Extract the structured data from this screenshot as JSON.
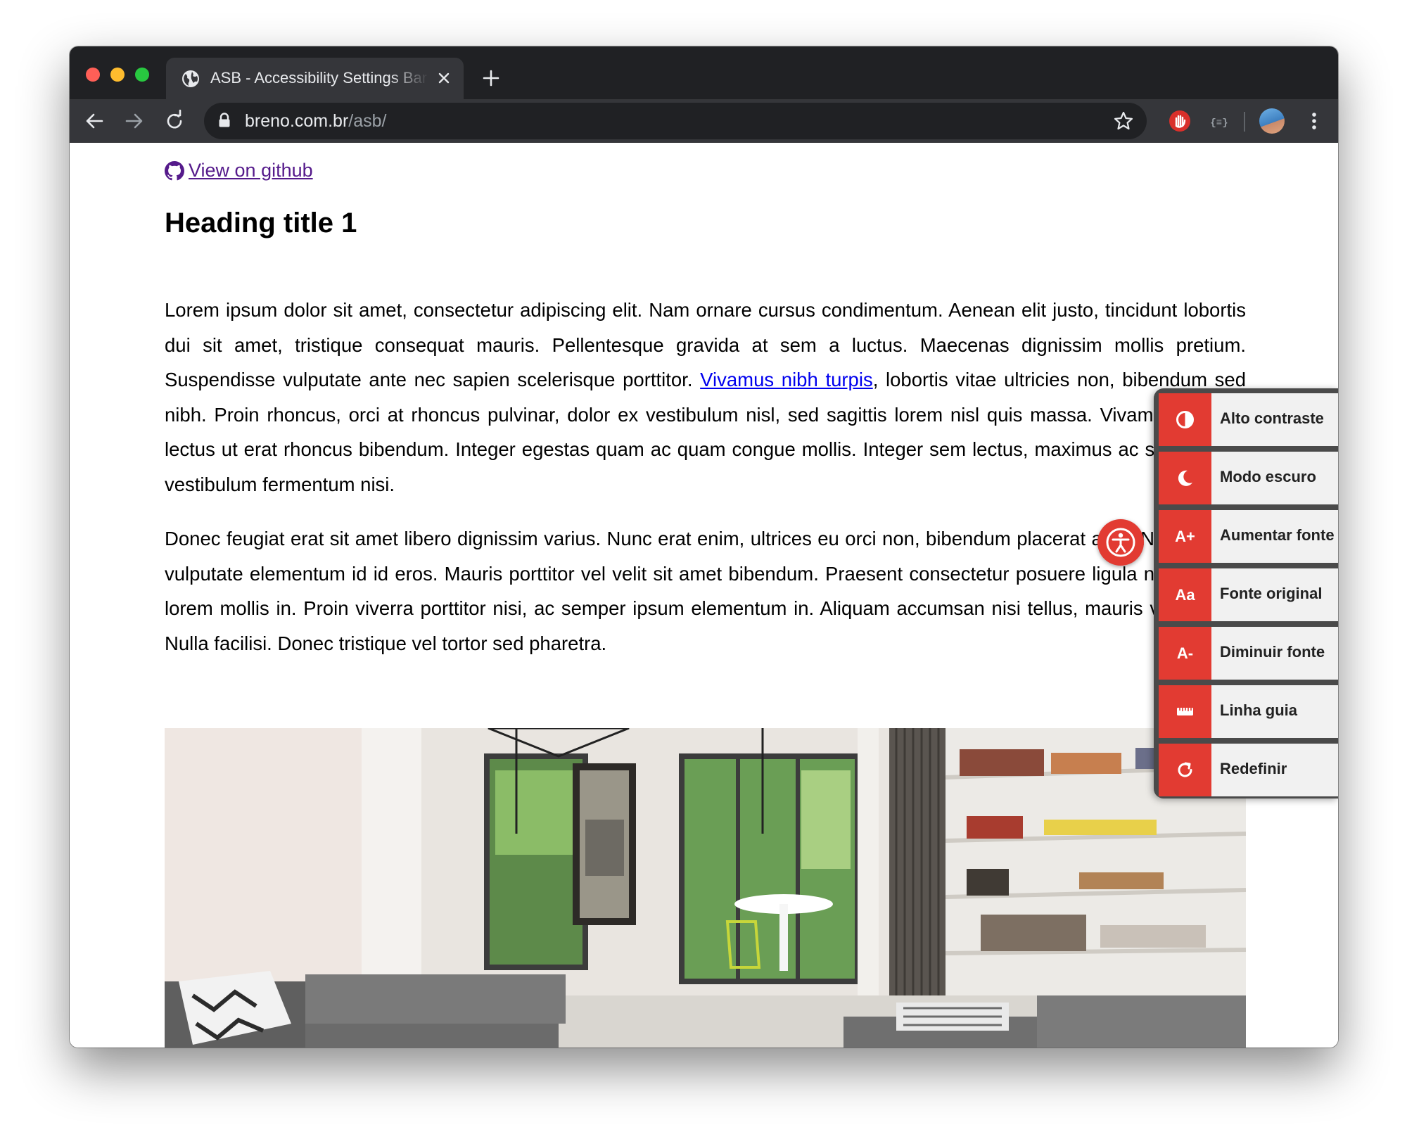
{
  "browser": {
    "tab_title": "ASB - Accessibility Settings Bar",
    "url_host": "breno.com.br",
    "url_path": "/asb/"
  },
  "page": {
    "github_link": "View on github",
    "heading": "Heading title 1",
    "paragraph1": {
      "before_link": "Lorem ipsum dolor sit amet, consectetur adipiscing elit. Nam ornare cursus condimentum. Aenean elit justo, tincidunt lobortis dui sit amet, tristique consequat mauris. Pellentesque gravida at sem a luctus. Maecenas dignissim mollis pretium. Suspendisse vulputate ante nec sapien scelerisque porttitor. ",
      "link": "Vivamus nibh turpis",
      "after_link": ", lobortis vitae ultricies non, bibendum sed nibh. Proin rhoncus, orci at rhoncus pulvinar, dolor ex vestibulum nisl, sed sagittis lorem nisl quis massa. Vivamus pretium lectus ut erat rhoncus bibendum. Integer egestas quam ac quam congue mollis. Integer sem lectus, maximus ac sapien non, vestibulum fermentum nisi."
    },
    "paragraph2": "Donec feugiat erat sit amet libero dignissim varius. Nunc erat enim, ultrices eu orci non, bibendum placerat arcu. Nulla in velit vulputate elementum id id eros. Mauris porttitor vel velit sit amet bibendum. Praesent consectetur posuere ligula nec suscipit lorem mollis in. Proin viverra porttitor nisi, ac semper ipsum elementum in. Aliquam accumsan nisi tellus, mauris varius non. Nulla facilisi. Donec tristique vel tortor sed pharetra."
  },
  "accessibility_bar": {
    "accent_color": "#e23b32",
    "items": [
      {
        "icon": "contrast-icon",
        "badge": "",
        "label": "Alto contraste"
      },
      {
        "icon": "moon-icon",
        "badge": "",
        "label": "Modo escuro"
      },
      {
        "icon": "",
        "badge": "A+",
        "label": "Aumentar fonte"
      },
      {
        "icon": "",
        "badge": "Aa",
        "label": "Fonte original"
      },
      {
        "icon": "",
        "badge": "A-",
        "label": "Diminuir fonte"
      },
      {
        "icon": "ruler-icon",
        "badge": "",
        "label": "Linha guia"
      },
      {
        "icon": "reset-icon",
        "badge": "",
        "label": "Redefinir"
      }
    ]
  }
}
